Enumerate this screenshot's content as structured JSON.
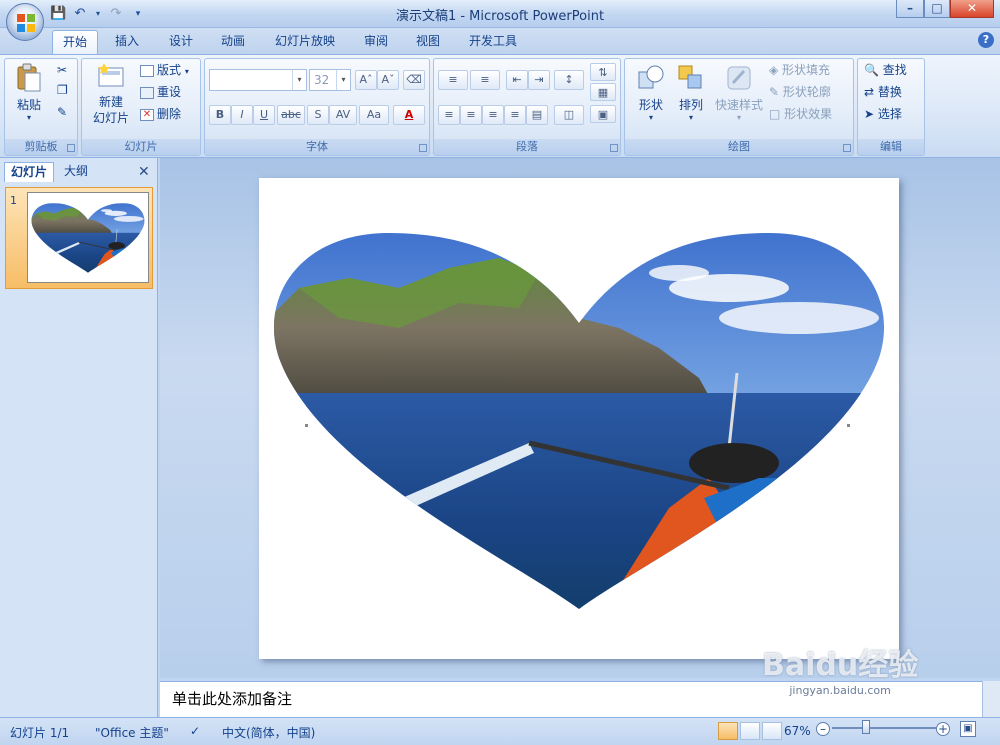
{
  "window": {
    "title": "演示文稿1 - Microsoft PowerPoint"
  },
  "tabs": [
    {
      "label": "开始",
      "active": true
    },
    {
      "label": "插入"
    },
    {
      "label": "设计"
    },
    {
      "label": "动画"
    },
    {
      "label": "幻灯片放映"
    },
    {
      "label": "审阅"
    },
    {
      "label": "视图"
    },
    {
      "label": "开发工具"
    }
  ],
  "ribbon": {
    "clipboard": {
      "label": "剪贴板",
      "paste": "粘贴"
    },
    "slides": {
      "label": "幻灯片",
      "new_slide": "新建\n幻灯片",
      "layout": "版式",
      "reset": "重设",
      "delete": "删除"
    },
    "font": {
      "label": "字体",
      "font_name": "",
      "font_size": "32"
    },
    "paragraph": {
      "label": "段落"
    },
    "drawing": {
      "label": "绘图",
      "shapes": "形状",
      "arrange": "排列",
      "quick_styles": "快速样式",
      "shape_fill": "形状填充",
      "shape_outline": "形状轮廓",
      "shape_effects": "形状效果"
    },
    "editing": {
      "label": "编辑",
      "find": "查找",
      "replace": "替换",
      "select": "选择"
    }
  },
  "panel": {
    "tab_slides": "幻灯片",
    "tab_outline": "大纲",
    "slide_number": "1"
  },
  "notes": {
    "placeholder": "单击此处添加备注"
  },
  "status": {
    "slide_info": "幻灯片 1/1",
    "theme": "\"Office 主题\"",
    "language": "中文(简体，中国)",
    "zoom": "67%",
    "zoom_level": 0.67
  },
  "watermark": {
    "text": "Baidu经验",
    "sub": "jingyan.baidu.com"
  },
  "colors": {
    "accent": "#15428b",
    "ribbon": "#dbe7f7",
    "selected": "#f7bd66"
  }
}
